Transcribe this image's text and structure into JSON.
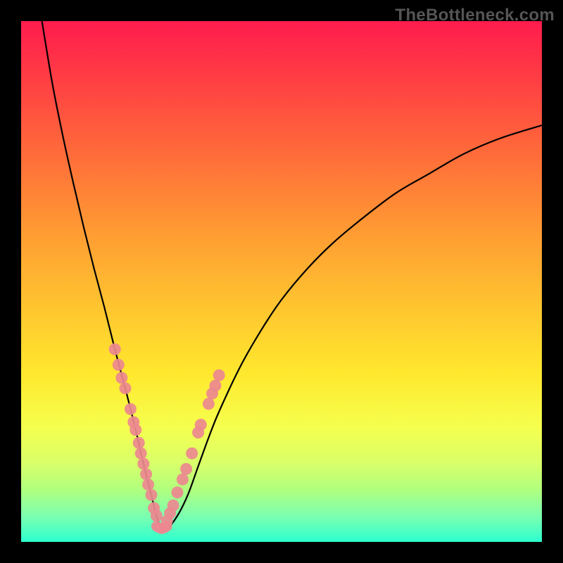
{
  "watermark": "TheBottleneck.com",
  "chart_data": {
    "type": "line",
    "title": "",
    "xlabel": "",
    "ylabel": "",
    "xlim": [
      0,
      100
    ],
    "ylim": [
      0,
      100
    ],
    "series": [
      {
        "name": "curve",
        "x": [
          4,
          6,
          8,
          10,
          12,
          14,
          16,
          18,
          20,
          22,
          23.5,
          25,
          26,
          27,
          28,
          30,
          32,
          34,
          36,
          38,
          42,
          46,
          50,
          55,
          60,
          66,
          72,
          78,
          85,
          92,
          100
        ],
        "y": [
          100,
          88,
          78,
          69,
          60.5,
          52.5,
          45,
          37,
          29.5,
          21.5,
          15,
          9,
          5,
          2.5,
          2.5,
          5,
          9,
          14.5,
          20,
          25,
          33.5,
          40.5,
          46.5,
          52.5,
          57.5,
          62.5,
          67,
          70.5,
          74.5,
          77.5,
          80
        ]
      }
    ],
    "data_markers": {
      "left_branch": [
        {
          "x": 18,
          "y": 37
        },
        {
          "x": 18.7,
          "y": 34
        },
        {
          "x": 19.3,
          "y": 31.5
        },
        {
          "x": 20,
          "y": 29.5
        },
        {
          "x": 21,
          "y": 25.5
        },
        {
          "x": 21.6,
          "y": 23
        },
        {
          "x": 22,
          "y": 21.5
        },
        {
          "x": 22.6,
          "y": 19
        },
        {
          "x": 23,
          "y": 17
        },
        {
          "x": 23.5,
          "y": 15
        },
        {
          "x": 24,
          "y": 13
        },
        {
          "x": 24.4,
          "y": 11
        },
        {
          "x": 25,
          "y": 9
        },
        {
          "x": 25.5,
          "y": 6.5
        },
        {
          "x": 26,
          "y": 5
        }
      ],
      "right_branch": [
        {
          "x": 28,
          "y": 4
        },
        {
          "x": 28.6,
          "y": 5.5
        },
        {
          "x": 29.2,
          "y": 7
        },
        {
          "x": 30,
          "y": 9.5
        },
        {
          "x": 31,
          "y": 12
        },
        {
          "x": 31.7,
          "y": 14
        },
        {
          "x": 32.8,
          "y": 17
        },
        {
          "x": 34,
          "y": 21
        },
        {
          "x": 34.5,
          "y": 22.5
        },
        {
          "x": 36,
          "y": 26.5
        },
        {
          "x": 36.7,
          "y": 28.5
        },
        {
          "x": 37.3,
          "y": 30
        },
        {
          "x": 38,
          "y": 32
        }
      ],
      "valley": [
        {
          "x": 26,
          "y": 3
        },
        {
          "x": 26.5,
          "y": 2.7
        },
        {
          "x": 27,
          "y": 2.5
        },
        {
          "x": 27.5,
          "y": 2.7
        },
        {
          "x": 28,
          "y": 3
        }
      ]
    },
    "marker_color": "#ed8890",
    "curve_color": "#000000"
  }
}
